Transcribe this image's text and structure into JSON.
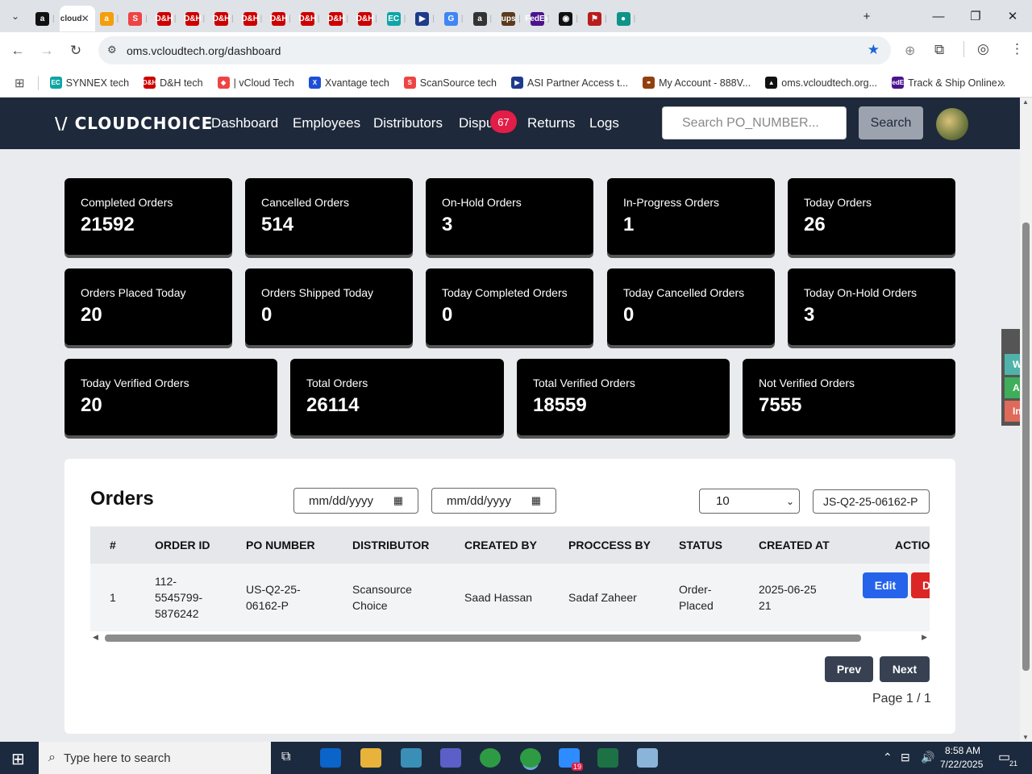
{
  "browser": {
    "tabs": [
      {
        "icon": "a",
        "color": "#111"
      },
      {
        "icon": "cloud",
        "color": "#fff"
      },
      {
        "icon": "a",
        "color": "#f59e0b"
      },
      {
        "icon": "S",
        "color": "#ef4444"
      },
      {
        "icon": "D&H",
        "color": "#c00"
      },
      {
        "icon": "D&H",
        "color": "#c00"
      },
      {
        "icon": "D&H",
        "color": "#c00"
      },
      {
        "icon": "D&H",
        "color": "#c00"
      },
      {
        "icon": "D&H",
        "color": "#c00"
      },
      {
        "icon": "D&H",
        "color": "#c00"
      },
      {
        "icon": "D&H",
        "color": "#c00"
      },
      {
        "icon": "D&H",
        "color": "#c00"
      },
      {
        "icon": "EC",
        "color": "#0ea5a5"
      },
      {
        "icon": "▶",
        "color": "#1e3a8a"
      },
      {
        "icon": "G",
        "color": "#4285f4"
      },
      {
        "icon": "a",
        "color": "#333"
      },
      {
        "icon": "ups",
        "color": "#5a3b1c"
      },
      {
        "icon": "FedEx",
        "color": "#4b148c"
      },
      {
        "icon": "◉",
        "color": "#111"
      },
      {
        "icon": "⚑",
        "color": "#b91c1c"
      },
      {
        "icon": "●",
        "color": "#0d9488"
      }
    ],
    "url": "oms.vcloudtech.org/dashboard",
    "bookmarks": [
      {
        "label": "SYNNEX tech",
        "icon": "EC",
        "color": "#0ea5a5"
      },
      {
        "label": "D&H tech",
        "icon": "D&H",
        "color": "#c00"
      },
      {
        "label": "| vCloud Tech",
        "icon": "◆",
        "color": "#ef4444"
      },
      {
        "label": "Xvantage tech",
        "icon": "X",
        "color": "#1d4ed8"
      },
      {
        "label": "ScanSource tech",
        "icon": "S",
        "color": "#ef4444"
      },
      {
        "label": "ASI Partner Access t...",
        "icon": "▶",
        "color": "#1e3a8a"
      },
      {
        "label": "My Account - 888V...",
        "icon": "⚭",
        "color": "#92400e"
      },
      {
        "label": "oms.vcloudtech.org...",
        "icon": "▲",
        "color": "#111"
      },
      {
        "label": "Track & Ship Online...",
        "icon": "FedEx",
        "color": "#4b148c"
      }
    ]
  },
  "app": {
    "logo": "\\/ CLOUDCHOICE",
    "nav": [
      "Dashboard",
      "Employees",
      "Distributors",
      "Dispu",
      "Returns",
      "Logs"
    ],
    "disputes_badge": "67",
    "search_placeholder": "Search PO_NUMBER...",
    "search_button": "Search"
  },
  "stats_row1": [
    {
      "label": "Completed Orders",
      "value": "21592"
    },
    {
      "label": "Cancelled Orders",
      "value": "514"
    },
    {
      "label": "On-Hold Orders",
      "value": "3"
    },
    {
      "label": "In-Progress Orders",
      "value": "1"
    },
    {
      "label": "Today Orders",
      "value": "26"
    }
  ],
  "stats_row2": [
    {
      "label": "Orders Placed Today",
      "value": "20"
    },
    {
      "label": "Orders Shipped Today",
      "value": "0"
    },
    {
      "label": "Today Completed Orders",
      "value": "0"
    },
    {
      "label": "Today Cancelled Orders",
      "value": "0"
    },
    {
      "label": "Today On-Hold Orders",
      "value": "3"
    }
  ],
  "stats_row3": [
    {
      "label": "Today Verified Orders",
      "value": "20"
    },
    {
      "label": "Total Orders",
      "value": "26114"
    },
    {
      "label": "Total Verified Orders",
      "value": "18559"
    },
    {
      "label": "Not Verified Orders",
      "value": "7555"
    }
  ],
  "orders": {
    "title": "Orders",
    "date_from": "mm/dd/yyyy",
    "date_to": "mm/dd/yyyy",
    "page_size": "10",
    "filter_value": "JS-Q2-25-06162-P",
    "columns": [
      "#",
      "ORDER ID",
      "PO NUMBER",
      "DISTRIBUTOR",
      "CREATED BY",
      "PROCCESS BY",
      "STATUS",
      "CREATED AT",
      "ACTIO"
    ],
    "rows": [
      {
        "num": "1",
        "order_id": [
          "112-",
          "5545799-",
          "5876242"
        ],
        "po_number": [
          "US-Q2-25-",
          "06162-P"
        ],
        "distributor": [
          "Scansource",
          "Choice"
        ],
        "created_by": "Saad Hassan",
        "process_by": "Sadaf Zaheer",
        "status": [
          "Order-",
          "Placed"
        ],
        "created_at": [
          "2025-06-25",
          "21"
        ],
        "edit": "Edit",
        "delete": "D"
      }
    ],
    "prev": "Prev",
    "next": "Next",
    "page_info": "Page 1 / 1"
  },
  "side_widget": [
    {
      "label": "Wor",
      "color": "#4fb3a9"
    },
    {
      "label": "Acti",
      "color": "#3fae5a"
    },
    {
      "label": "In A",
      "color": "#e06a5a"
    }
  ],
  "taskbar": {
    "search_placeholder": "Type here to search",
    "time": "8:58 AM",
    "date": "7/22/2025",
    "notification_count": "21",
    "zoom_badge": "19"
  }
}
